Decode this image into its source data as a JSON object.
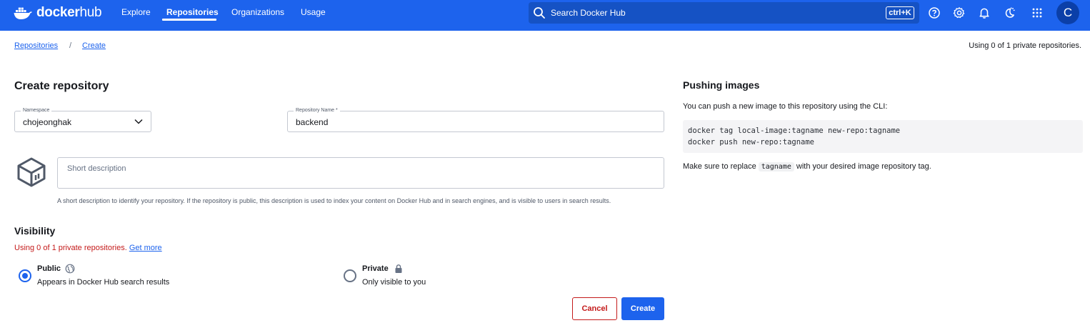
{
  "nav": {
    "logo_bold": "docker",
    "logo_thin": "hub",
    "links": [
      "Explore",
      "Repositories",
      "Organizations",
      "Usage"
    ],
    "active": "Repositories",
    "search_placeholder": "Search Docker Hub",
    "search_shortcut": "ctrl+K",
    "icons": [
      "help-icon",
      "gear-icon",
      "bell-icon",
      "theme-icon",
      "apps-grid-icon"
    ],
    "avatar_initial": "C"
  },
  "breadcrumb": {
    "items": [
      "Repositories",
      "Create"
    ],
    "separator": "/"
  },
  "usage_summary": "Using 0 of 1 private repositories.",
  "form": {
    "title": "Create repository",
    "namespace_label": "Namespace",
    "namespace_value": "chojeonghak",
    "repo_name_label": "Repository Name *",
    "repo_name_value": "backend",
    "description_placeholder": "Short description",
    "description_help": "A short description to identify your repository. If the repository is public, this description is used to index your content on Docker Hub and in search engines, and is visible to users in search results.",
    "visibility_title": "Visibility",
    "visibility_warning": "Using 0 of 1 private repositories.",
    "visibility_link": "Get more",
    "public_title": "Public",
    "public_sub": "Appears in Docker Hub search results",
    "private_title": "Private",
    "private_sub": "Only visible to you",
    "selected_visibility": "Public",
    "cancel_label": "Cancel",
    "create_label": "Create"
  },
  "push_panel": {
    "title": "Pushing images",
    "intro": "You can push a new image to this repository using the CLI:",
    "code_lines": [
      "docker tag local-image:tagname new-repo:tagname",
      "docker push new-repo:tagname"
    ],
    "note_prefix": "Make sure to replace",
    "note_tag": "tagname",
    "note_suffix": "with your desired image repository tag."
  },
  "colors": {
    "brand_blue": "#1d63ed",
    "danger_red": "#c41b1b"
  }
}
